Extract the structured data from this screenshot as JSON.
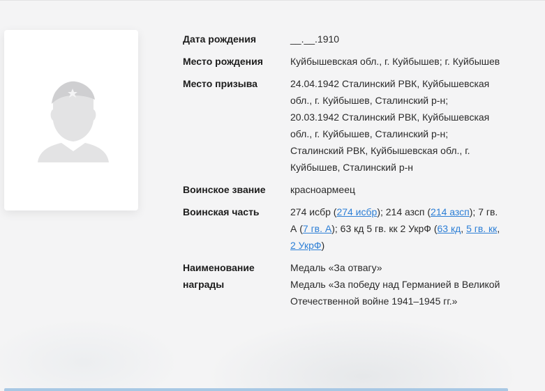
{
  "photo": {
    "alt_icon": "soldier-silhouette-icon"
  },
  "fields": {
    "birth_date": {
      "label": "Дата рождения",
      "value": "__.__.1910"
    },
    "birth_place": {
      "label": "Место рождения",
      "value": "Куйбышевская обл., г. Куйбышев; г. Куйбышев"
    },
    "draft_place": {
      "label": "Место призыва",
      "lines": [
        "24.04.1942 Сталинский РВК, Куйбышевская обл., г. Куйбышев, Сталинский р-н;",
        "20.03.1942 Сталинский РВК, Куйбышевская обл., г. Куйбышев, Сталинский р-н;",
        "Сталинский РВК, Куйбышевская обл., г. Куйбышев, Сталинский р-н"
      ]
    },
    "rank": {
      "label": "Воинское звание",
      "value": "красноармеец"
    },
    "unit": {
      "label": "Воинская часть",
      "t1": "274 исбр (",
      "l1": "274 исбр",
      "t2": "); 214 азсп (",
      "l2": "214 азсп",
      "t3": "); 7 гв. А (",
      "l3": "7 гв. А",
      "t4": "); 63 кд 5 гв. кк 2 УкрФ (",
      "l4": "63 кд",
      "t5": ", ",
      "l5": "5 гв. кк",
      "t6": ", ",
      "l6": "2 УкрФ",
      "t7": ")"
    },
    "award": {
      "label": "Наименование награды",
      "lines": [
        "Медаль «За отвагу»",
        "Медаль «За победу над Германией в Великой Отечественной войне 1941–1945 гг.»"
      ]
    }
  },
  "colors": {
    "link": "#2d7fd6",
    "background": "#f4f4f5",
    "card": "#ffffff"
  }
}
